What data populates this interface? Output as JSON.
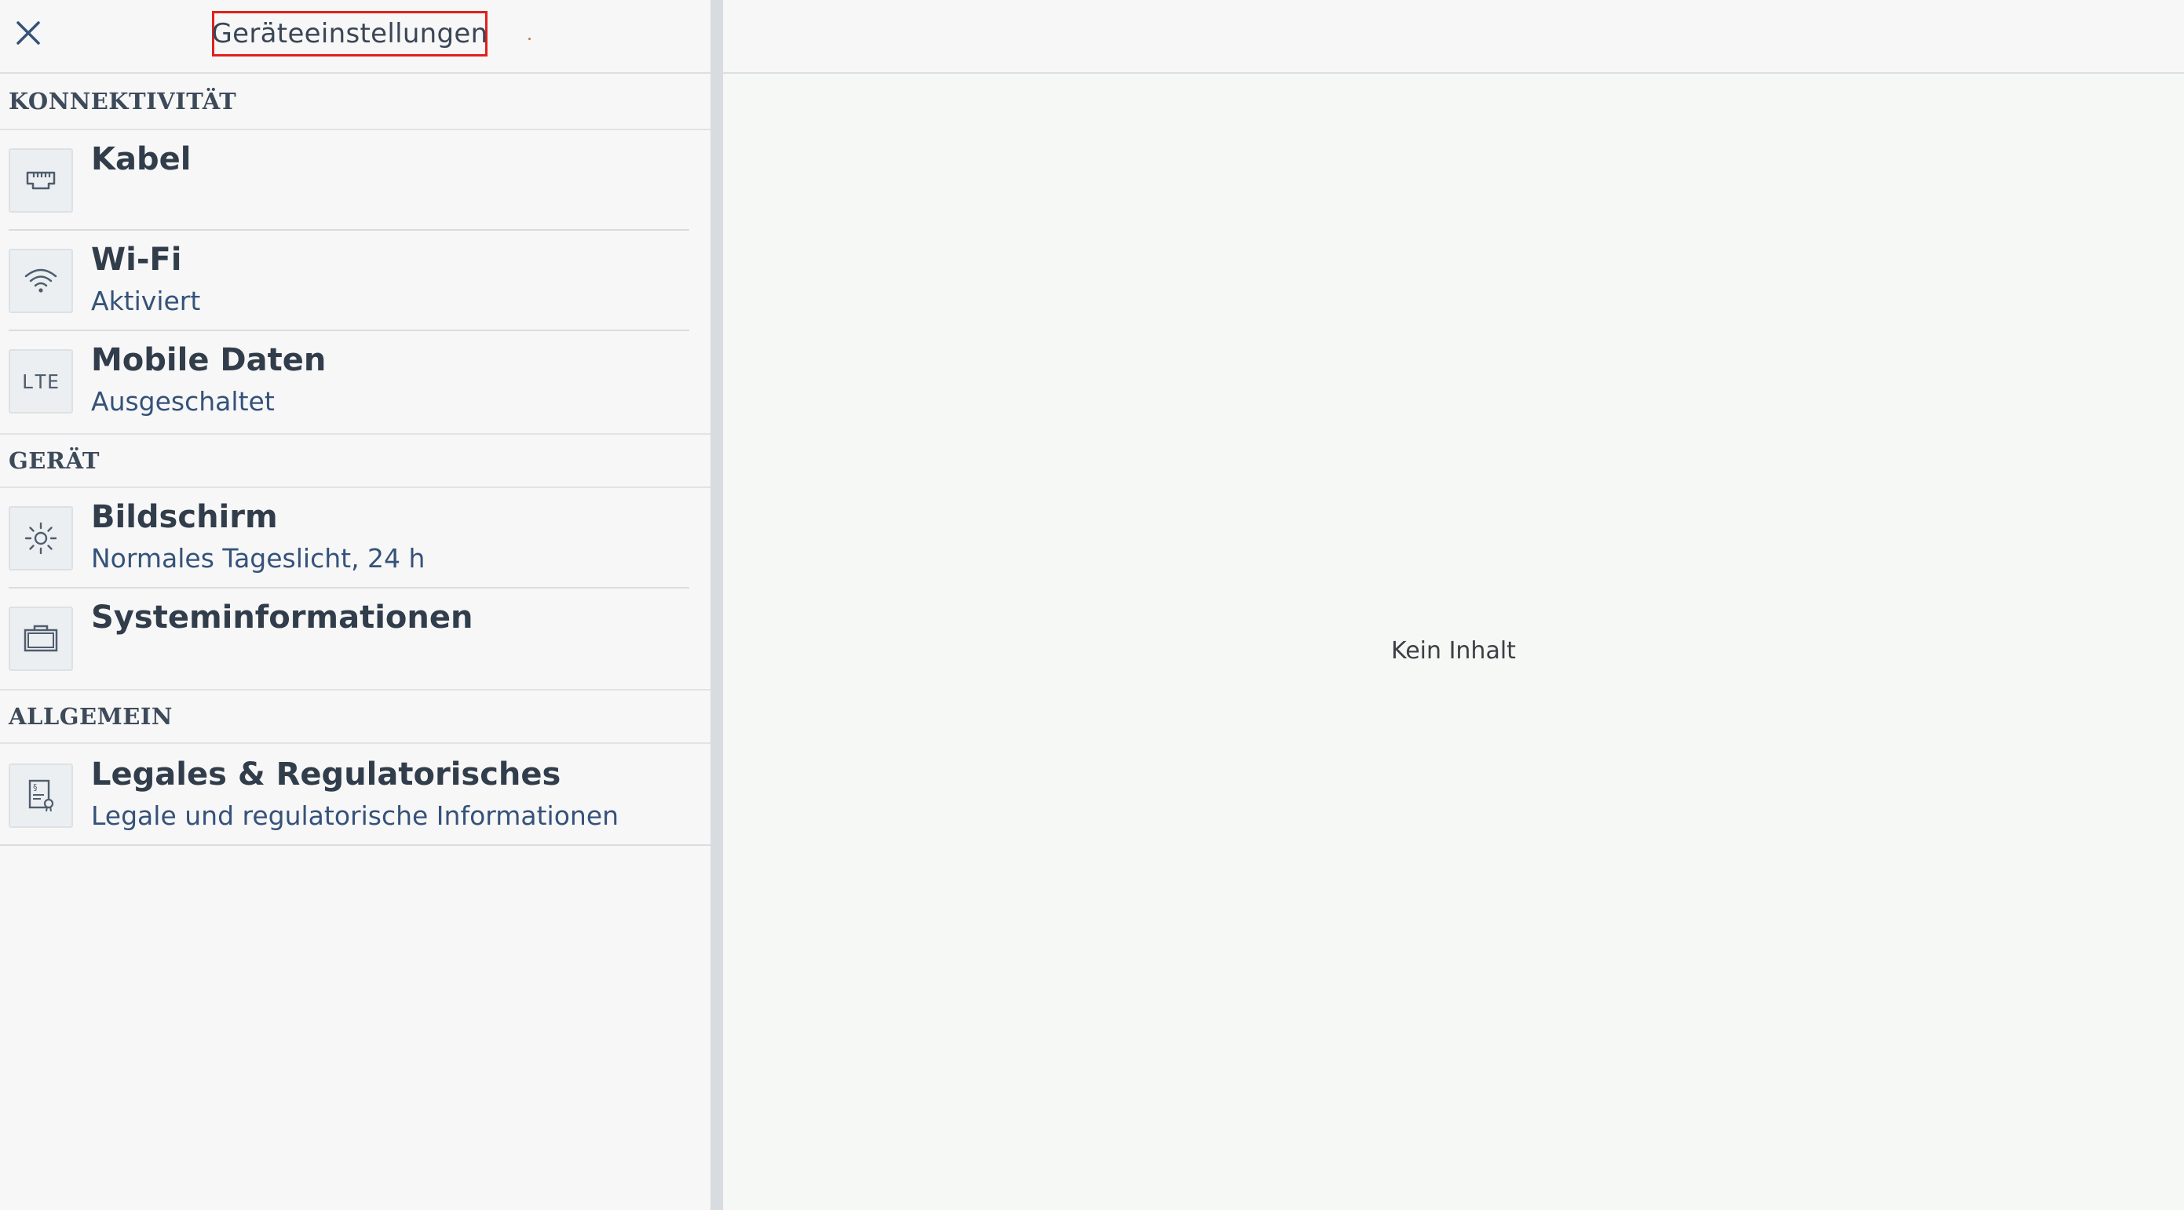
{
  "header": {
    "title": "Geräteeinstellungen",
    "close_icon": "close-icon"
  },
  "sections": [
    {
      "label": "KONNEKTIVITÄT",
      "items": [
        {
          "title": "Kabel",
          "subtitle": "",
          "icon": "ethernet-port-icon"
        },
        {
          "title": "Wi-Fi",
          "subtitle": "Aktiviert",
          "icon": "wifi-icon"
        },
        {
          "title": "Mobile Daten",
          "subtitle": "Ausgeschaltet",
          "icon": "lte-icon",
          "icon_text": "LTE"
        }
      ]
    },
    {
      "label": "GERÄT",
      "items": [
        {
          "title": "Bildschirm",
          "subtitle": "Normales Tageslicht, 24 h",
          "icon": "brightness-icon"
        },
        {
          "title": "Systeminformationen",
          "subtitle": "",
          "icon": "system-info-icon"
        }
      ]
    },
    {
      "label": "ALLGEMEIN",
      "items": [
        {
          "title": "Legales & Regulatorisches",
          "subtitle": "Legale und regulatorische Informationen",
          "icon": "legal-document-icon"
        }
      ]
    }
  ],
  "detail": {
    "empty_text": "Kein Inhalt"
  },
  "colors": {
    "highlight_border": "#e0201c",
    "subtitle_text": "#35527a",
    "title_text": "#313d4b"
  }
}
